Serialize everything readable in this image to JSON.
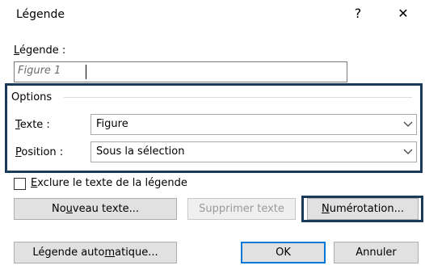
{
  "dialog": {
    "title": "Légende",
    "help_glyph": "?",
    "close_glyph": "✕"
  },
  "caption": {
    "label_u": "L",
    "label_rest": "égende :",
    "value": "Figure 1"
  },
  "options": {
    "group_label": "Options",
    "text_label_u": "T",
    "text_label_rest": "exte :",
    "text_value": "Figure",
    "position_label_u": "P",
    "position_label_rest": "osition :",
    "position_value": "Sous la sélection"
  },
  "exclude": {
    "u": "E",
    "rest": "xclure le texte de la légende",
    "checked": false
  },
  "buttons": {
    "new_pre": "No",
    "new_u": "u",
    "new_post": "veau texte...",
    "delete": "Supprimer texte",
    "numbering_u": "N",
    "numbering_rest": "umérotation...",
    "auto_pre": "Légende auto",
    "auto_u": "m",
    "auto_post": "atique...",
    "ok": "OK",
    "cancel": "Annuler"
  },
  "colors": {
    "highlight_border": "#1a3a5a",
    "default_button_border": "#0078d7"
  }
}
